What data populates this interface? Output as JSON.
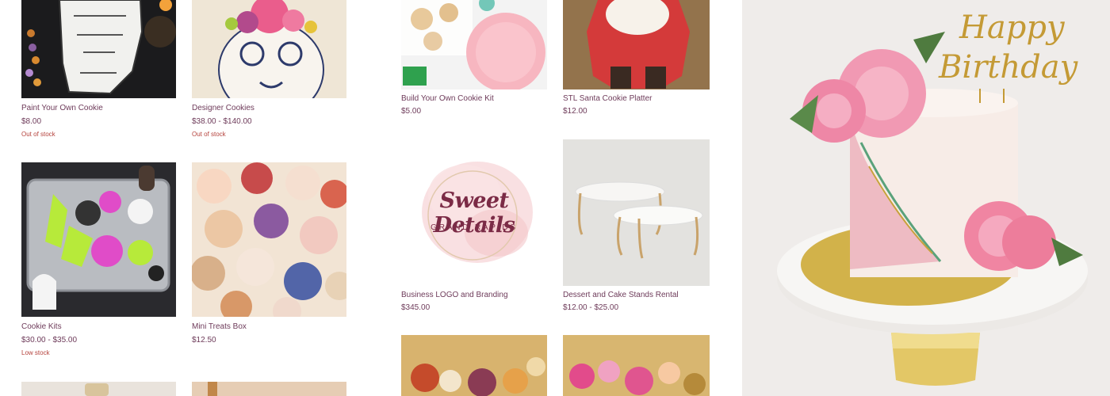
{
  "products_left": [
    {
      "name": "Paint Your Own Cookie",
      "price": "$8.00",
      "stock": "Out of stock",
      "image": "halloween-paint-cookie-photo"
    },
    {
      "name": "Designer Cookies",
      "price": "$38.00 - $140.00",
      "stock": "Out of stock",
      "image": "sugar-skull-cookie-photo"
    },
    {
      "name": "Cookie Kits",
      "price": "$30.00 - $35.00",
      "stock": "Low stock",
      "image": "halloween-cookie-tray-photo"
    },
    {
      "name": "Mini Treats Box",
      "price": "$12.50",
      "stock": "",
      "image": "mini-treats-photo"
    }
  ],
  "products_mid": [
    {
      "name": "Build Your Own Cookie Kit",
      "price": "$5.00",
      "image": "cookie-kit-photo"
    },
    {
      "name": "STL Santa Cookie Platter",
      "price": "$12.00",
      "image": "santa-cookie-photo"
    },
    {
      "name": "Business LOGO and Branding",
      "price": "$345.00",
      "image": "brand-logo-image"
    },
    {
      "name": "Dessert and Cake Stands Rental",
      "price": "$12.00 - $25.00",
      "image": "cake-stands-photo"
    }
  ],
  "logo": {
    "line1": "Sweet Details",
    "line2": "GRAND RAPIDS"
  },
  "cake_topper": {
    "line1": "Happy",
    "line2": "Birthday"
  },
  "colors": {
    "product_text": "#6e3b5a",
    "stock_text": "#b5433d",
    "accent_gold": "#c9a24a"
  }
}
